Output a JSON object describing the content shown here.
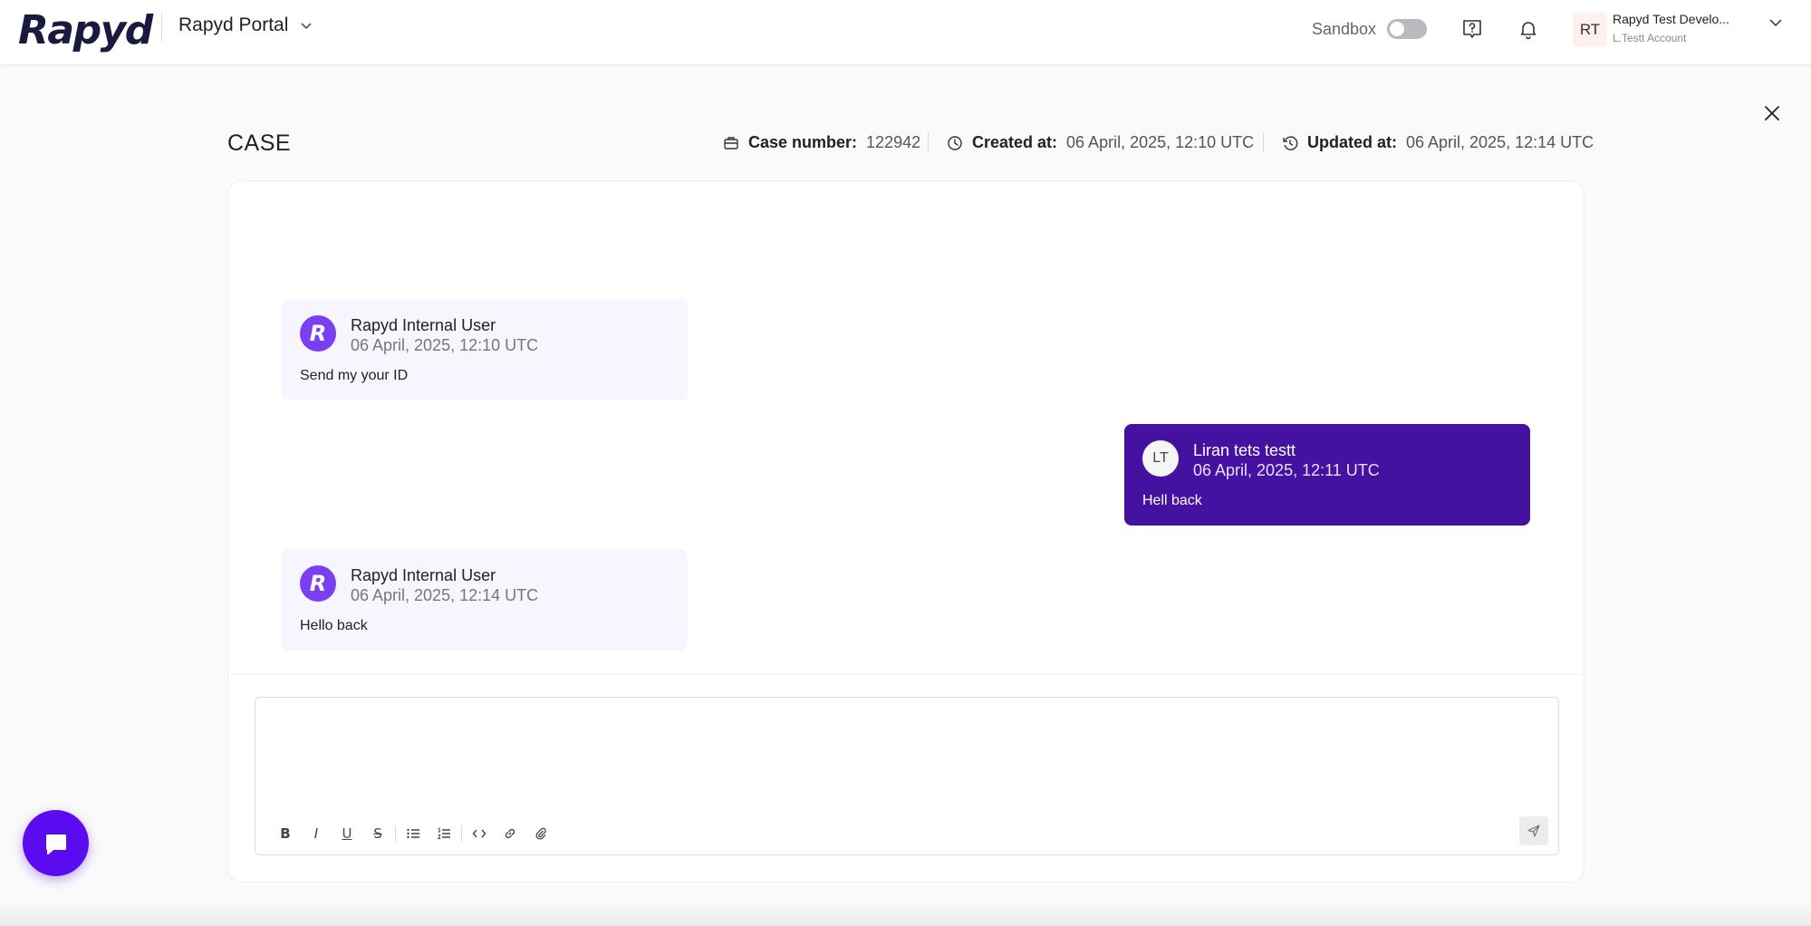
{
  "header": {
    "logo_text": "Rapyd",
    "portal_label": "Rapyd Portal",
    "sandbox_label": "Sandbox",
    "sandbox_on": false,
    "account": {
      "initials": "RT",
      "name": "Rapyd Test Develo...",
      "sub": "L.Testt Account"
    }
  },
  "case": {
    "title": "CASE",
    "case_number_label": "Case number:",
    "case_number": "122942",
    "created_label": "Created at:",
    "created": "06 April, 2025, 12:10 UTC",
    "updated_label": "Updated at:",
    "updated": "06 April, 2025, 12:14 UTC"
  },
  "messages": [
    {
      "author": "Rapyd Internal User",
      "time": "06 April, 2025, 12:10 UTC",
      "text": "Send my your ID",
      "avatar": "R"
    },
    {
      "author": "Liran tets testt",
      "time": "06 April, 2025, 12:11 UTC",
      "text": "Hell back",
      "avatar": "LT"
    },
    {
      "author": "Rapyd Internal User",
      "time": "06 April, 2025, 12:14 UTC",
      "text": "Hello back",
      "avatar": "R"
    }
  ],
  "editor": {
    "toolbar": {
      "bold": "B",
      "italic": "I",
      "underline": "U",
      "strike": "S"
    }
  },
  "colors": {
    "accent": "#4511a0",
    "rapyd_avatar": "#7a3ff2",
    "fab": "#5a0bf0",
    "incoming_bg": "#f7f5fd"
  }
}
